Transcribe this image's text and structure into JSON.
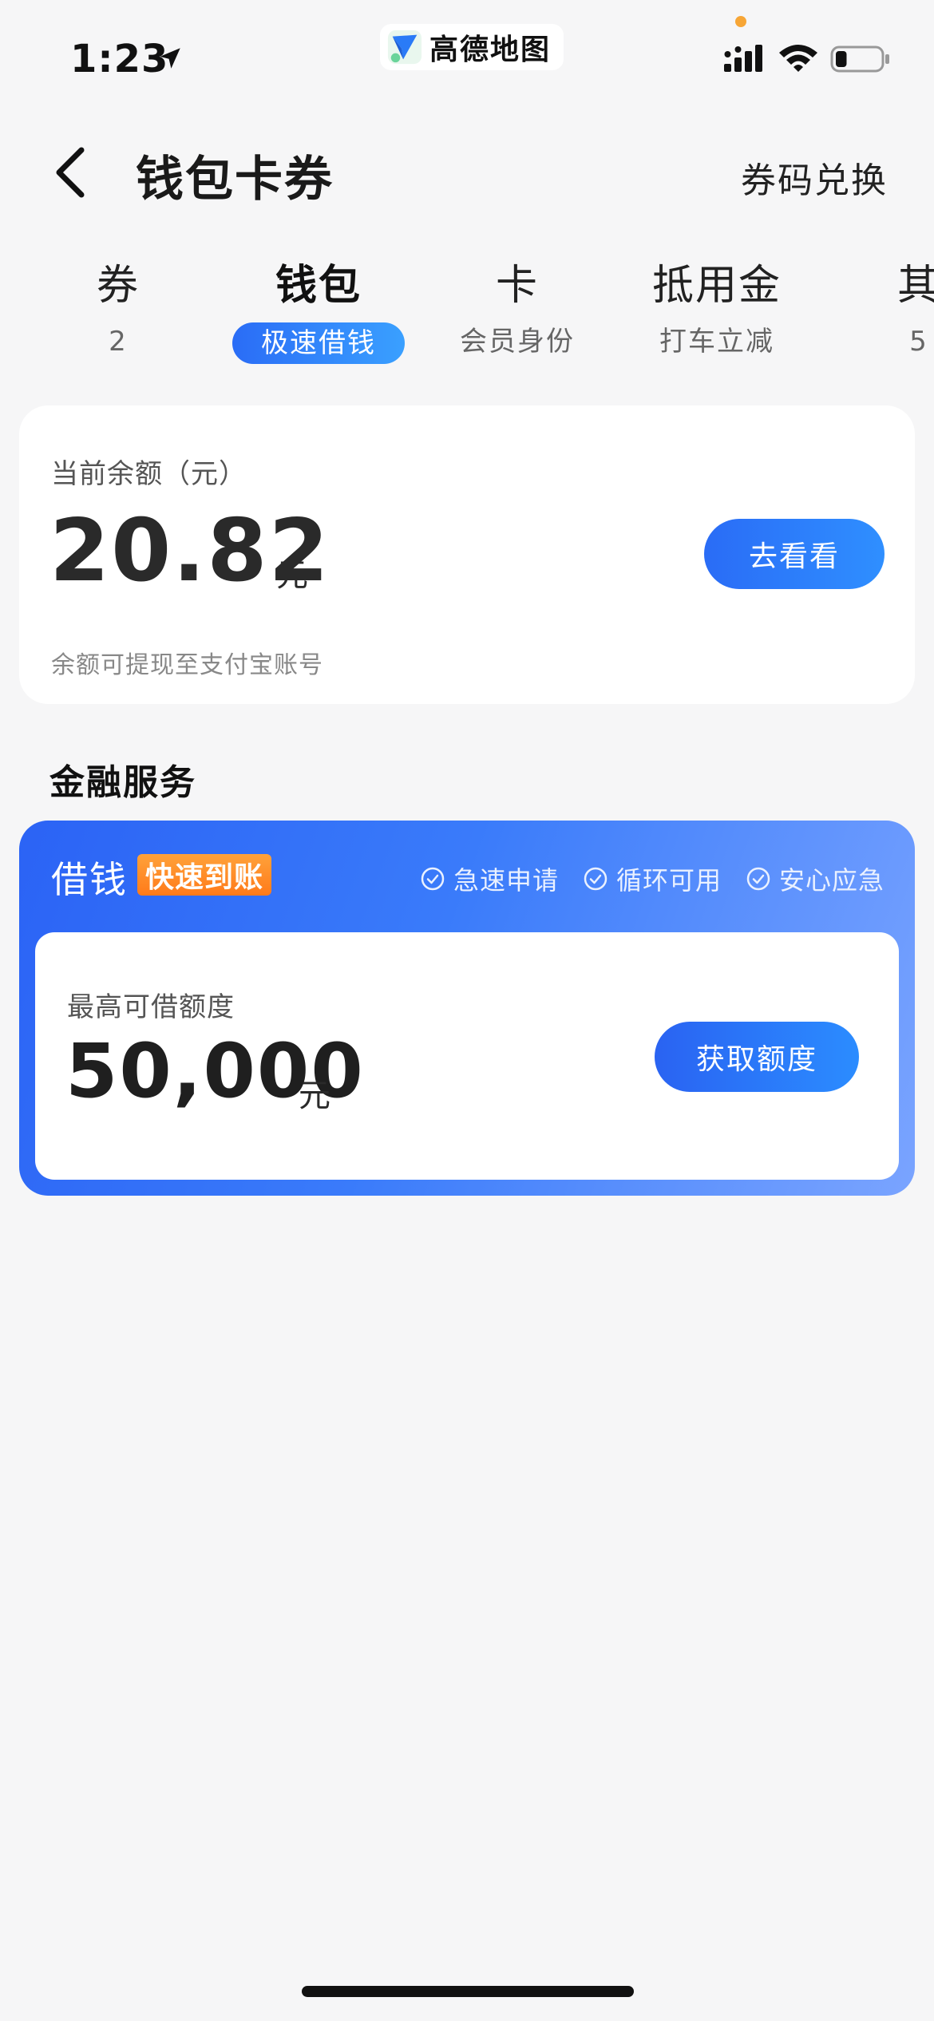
{
  "status_bar": {
    "time": "1:23",
    "app_name": "高德地图",
    "battery_level": 0.25
  },
  "header": {
    "title": "钱包卡券",
    "redeem_label": "券码兑换"
  },
  "tabs": [
    {
      "label": "券",
      "sub": "2",
      "active": false
    },
    {
      "label": "钱包",
      "sub": "极速借钱",
      "active": true
    },
    {
      "label": "卡",
      "sub": "会员身份",
      "active": false
    },
    {
      "label": "抵用金",
      "sub": "打车立减",
      "active": false
    },
    {
      "label": "其",
      "sub": "5",
      "active": false
    }
  ],
  "balance": {
    "label": "当前余额（元）",
    "amount": "20.82",
    "unit": "元",
    "hint": "余额可提现至支付宝账号",
    "button_label": "去看看"
  },
  "finance": {
    "section_title": "金融服务",
    "loan_title": "借钱",
    "badge": "快速到账",
    "features": [
      "急速申请",
      "循环可用",
      "安心应急"
    ],
    "limit_label": "最高可借额度",
    "limit_amount": "50,000",
    "limit_unit": "元",
    "button_label": "获取额度"
  },
  "colors": {
    "accent": "#2a6cf6",
    "badge": "#ff8a24",
    "background": "#f6f6f7"
  }
}
